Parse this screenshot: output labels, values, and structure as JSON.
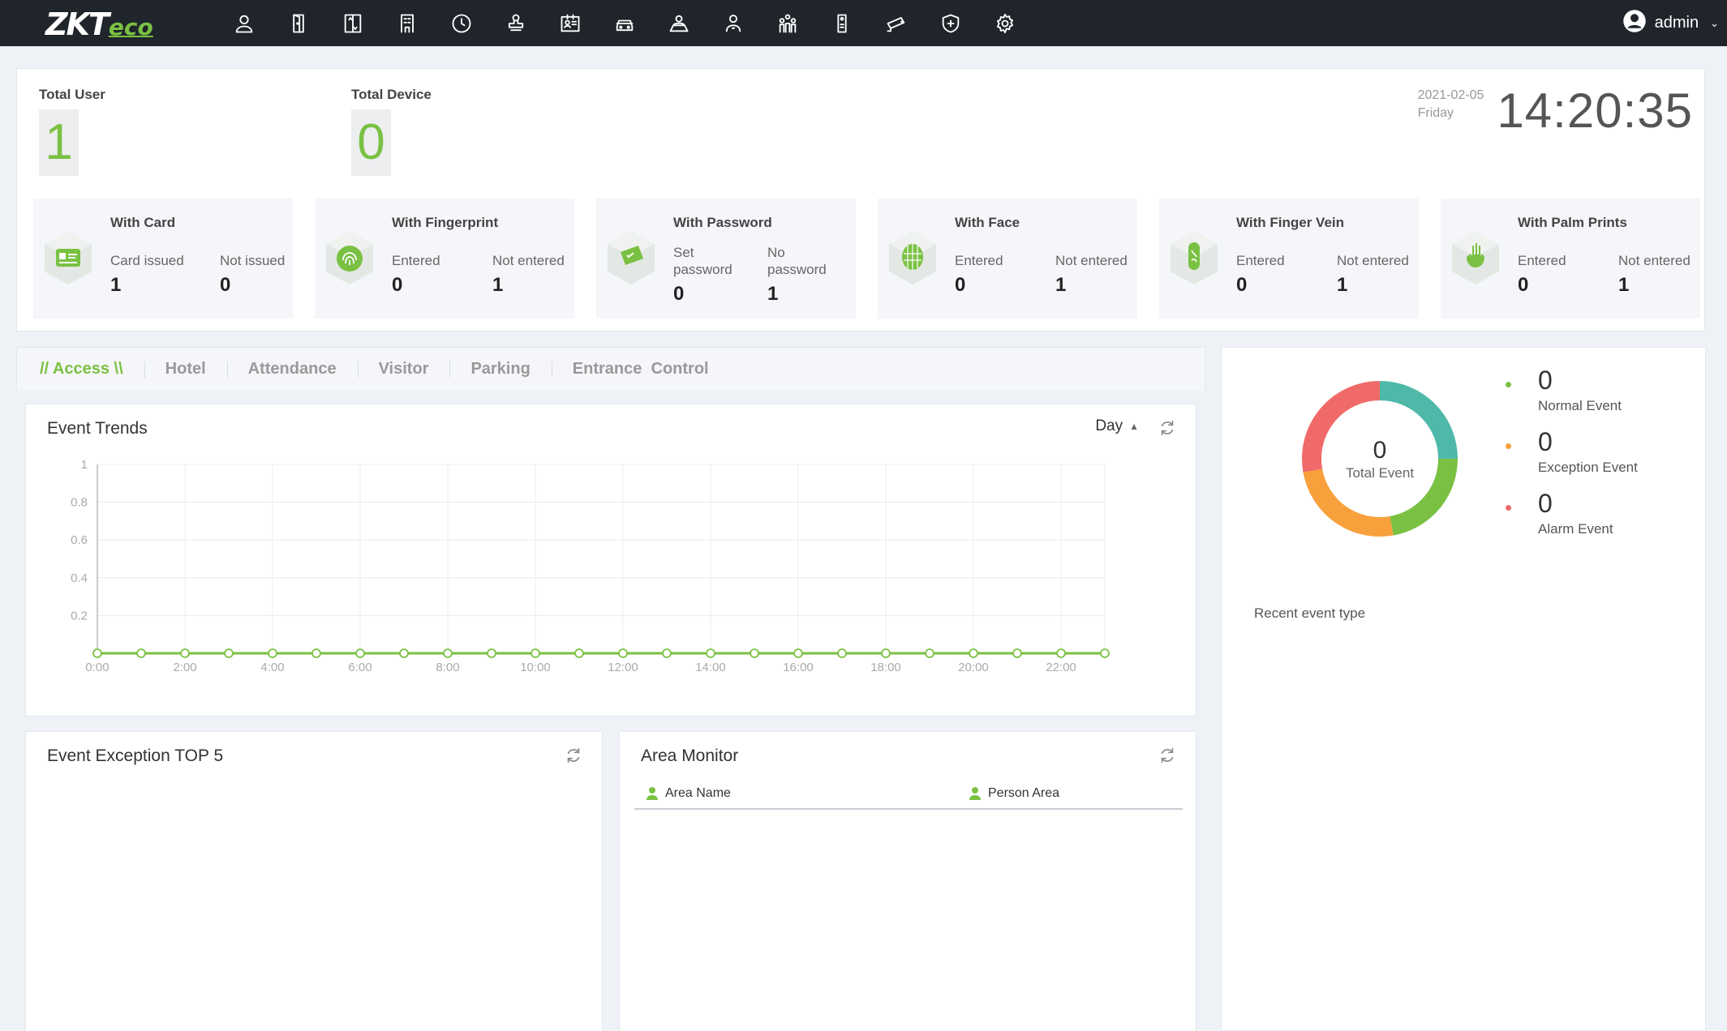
{
  "brand": {
    "zk": "ZKT",
    "eco": "eco"
  },
  "nav_icons": [
    "person-icon",
    "door-icon",
    "elevator-icon",
    "building-icon",
    "clock-icon",
    "stamp-icon",
    "id-card-icon",
    "car-icon",
    "meeting-icon",
    "badge-person-icon",
    "org-icon",
    "intercom-icon",
    "camera-icon",
    "shield-icon",
    "gear-icon"
  ],
  "user": {
    "name": "admin"
  },
  "stats": {
    "total_user_label": "Total User",
    "total_user_value": "1",
    "total_device_label": "Total Device",
    "total_device_value": "0",
    "date": "2021-02-05",
    "weekday": "Friday",
    "time": "14:20:35"
  },
  "cards": [
    {
      "title": "With Card",
      "icon": "card-cube-icon",
      "a_label": "Card issued",
      "a_value": "1",
      "b_label": "Not issued",
      "b_value": "0"
    },
    {
      "title": "With Fingerprint",
      "icon": "fingerprint-cube-icon",
      "a_label": "Entered",
      "a_value": "0",
      "b_label": "Not entered",
      "b_value": "1"
    },
    {
      "title": "With Password",
      "icon": "password-cube-icon",
      "a_label1": "Set",
      "a_label2": "password",
      "a_value": "0",
      "b_label1": "No",
      "b_label2": "password",
      "b_value": "1"
    },
    {
      "title": "With Face",
      "icon": "face-cube-icon",
      "a_label": "Entered",
      "a_value": "0",
      "b_label": "Not entered",
      "b_value": "1"
    },
    {
      "title": "With Finger Vein",
      "icon": "finger-vein-cube-icon",
      "a_label": "Entered",
      "a_value": "0",
      "b_label": "Not entered",
      "b_value": "1"
    },
    {
      "title": "With Palm Prints",
      "icon": "palm-cube-icon",
      "a_label": "Entered",
      "a_value": "0",
      "b_label": "Not entered",
      "b_value": "1"
    }
  ],
  "tabs": [
    "// Access \\\\",
    "Hotel",
    "Attendance",
    "Visitor",
    "Parking",
    "Entrance  Control"
  ],
  "trends": {
    "title": "Event Trends",
    "range": "Day"
  },
  "chart_data": {
    "type": "line",
    "x": [
      "0:00",
      "1:00",
      "2:00",
      "3:00",
      "4:00",
      "5:00",
      "6:00",
      "7:00",
      "8:00",
      "9:00",
      "10:00",
      "11:00",
      "12:00",
      "13:00",
      "14:00",
      "15:00",
      "16:00",
      "17:00",
      "18:00",
      "19:00",
      "20:00",
      "21:00",
      "22:00",
      "23:00"
    ],
    "x_tick_labels": [
      "0:00",
      "2:00",
      "4:00",
      "6:00",
      "8:00",
      "10:00",
      "12:00",
      "14:00",
      "16:00",
      "18:00",
      "20:00",
      "22:00"
    ],
    "series": [
      {
        "values": [
          0,
          0,
          0,
          0,
          0,
          0,
          0,
          0,
          0,
          0,
          0,
          0,
          0,
          0,
          0,
          0,
          0,
          0,
          0,
          0,
          0,
          0,
          0,
          0
        ]
      }
    ],
    "y_ticks": [
      "1",
      "0.8",
      "0.6",
      "0.4",
      "0.2"
    ],
    "ylim": [
      0,
      1
    ],
    "grid": true,
    "color": "#7ac143"
  },
  "exception": {
    "title": "Event Exception TOP 5"
  },
  "area": {
    "title": "Area Monitor",
    "col1": "Area Name",
    "col2": "Person Area"
  },
  "events": {
    "total": "0",
    "total_label": "Total Event",
    "items": [
      {
        "value": "0",
        "label": "Normal Event",
        "color": "#7ac143"
      },
      {
        "value": "0",
        "label": "Exception Event",
        "color": "#f7a03c"
      },
      {
        "value": "0",
        "label": "Alarm Event",
        "color": "#f06a6a"
      }
    ],
    "recent_label": "Recent event type",
    "ring_colors": [
      "#4fb9a9",
      "#7ac143",
      "#f7a03c",
      "#f06a6a"
    ]
  }
}
